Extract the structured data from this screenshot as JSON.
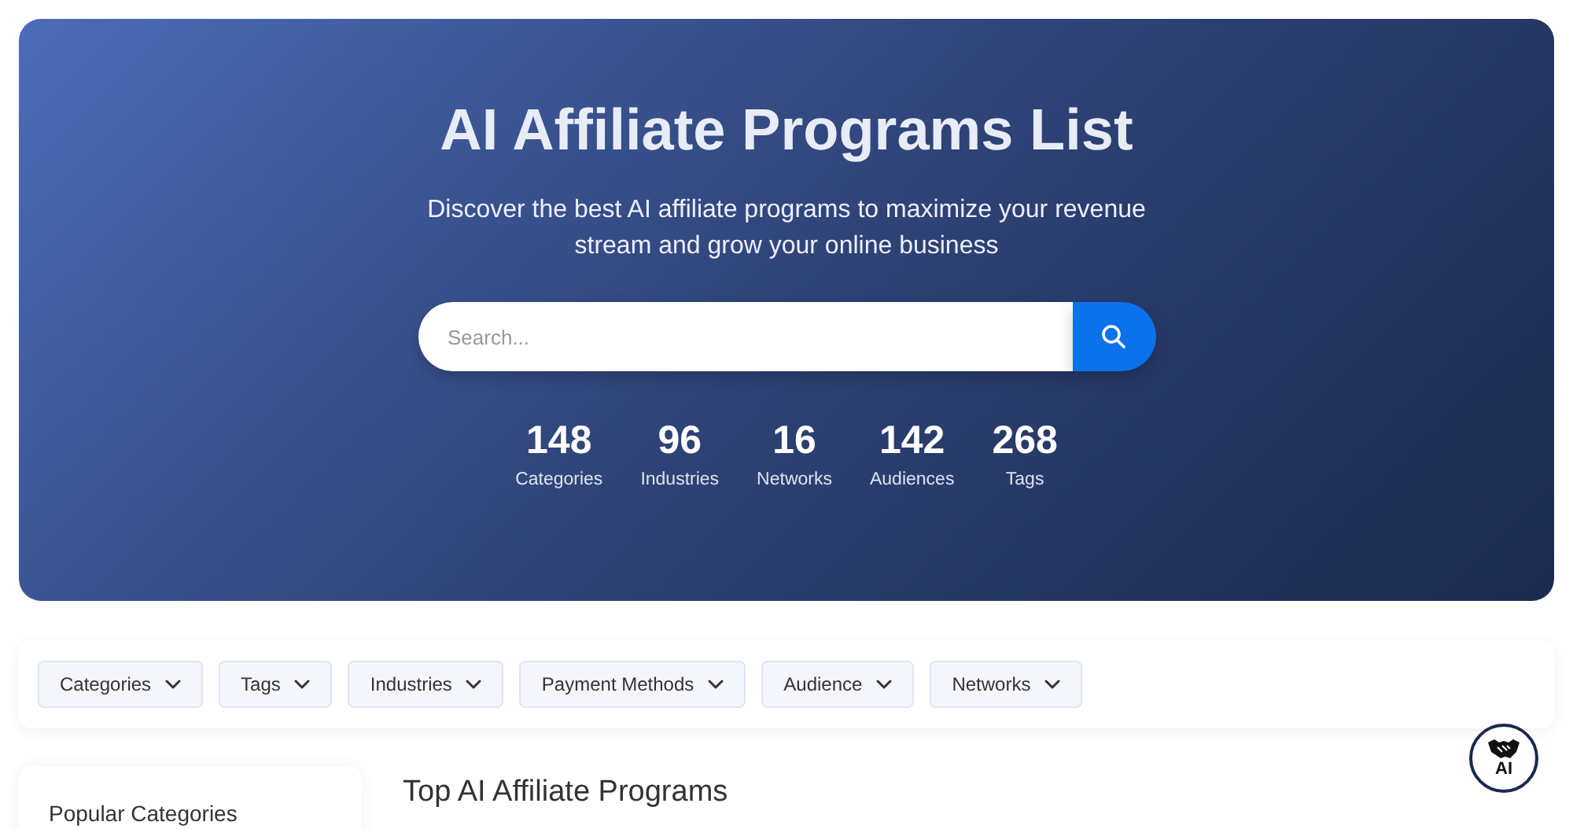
{
  "hero": {
    "title": "AI Affiliate Programs List",
    "subtitle": "Discover the best AI affiliate programs to maximize your revenue stream and grow your online business",
    "search": {
      "placeholder": "Search..."
    },
    "stats": [
      {
        "value": "148",
        "label": "Categories"
      },
      {
        "value": "96",
        "label": "Industries"
      },
      {
        "value": "16",
        "label": "Networks"
      },
      {
        "value": "142",
        "label": "Audiences"
      },
      {
        "value": "268",
        "label": "Tags"
      }
    ]
  },
  "filters": [
    "Categories",
    "Tags",
    "Industries",
    "Payment Methods",
    "Audience",
    "Networks"
  ],
  "sidebar": {
    "title": "Popular Categories"
  },
  "main": {
    "title": "Top AI Affiliate Programs"
  },
  "badge": {
    "label": "AI"
  }
}
